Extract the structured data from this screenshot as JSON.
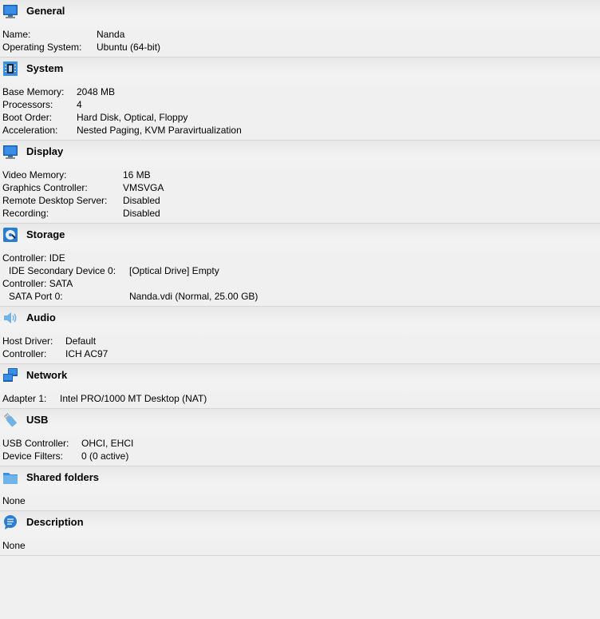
{
  "sections": {
    "general": {
      "title": "General",
      "icon": "monitor-icon",
      "rows": [
        {
          "label": "Name:",
          "value": "Nanda"
        },
        {
          "label": "Operating System:",
          "value": "Ubuntu (64-bit)"
        }
      ]
    },
    "system": {
      "title": "System",
      "icon": "chip-icon",
      "rows": [
        {
          "label": "Base Memory:",
          "value": "2048 MB"
        },
        {
          "label": "Processors:",
          "value": "4"
        },
        {
          "label": "Boot Order:",
          "value": "Hard Disk, Optical, Floppy"
        },
        {
          "label": "Acceleration:",
          "value": "Nested Paging, KVM Paravirtualization"
        }
      ]
    },
    "display": {
      "title": "Display",
      "icon": "monitor-icon",
      "rows": [
        {
          "label": "Video Memory:",
          "value": "16 MB"
        },
        {
          "label": "Graphics Controller:",
          "value": "VMSVGA"
        },
        {
          "label": "Remote Desktop Server:",
          "value": "Disabled"
        },
        {
          "label": "Recording:",
          "value": "Disabled"
        }
      ]
    },
    "storage": {
      "title": "Storage",
      "icon": "storage-disk-icon",
      "controller_ide": "Controller: IDE",
      "ide_device": {
        "label": "IDE Secondary Device 0:",
        "value": "[Optical Drive] Empty"
      },
      "controller_sata": "Controller: SATA",
      "sata_port": {
        "label": "SATA Port 0:",
        "value": "Nanda.vdi (Normal, 25.00 GB)"
      }
    },
    "audio": {
      "title": "Audio",
      "icon": "speaker-icon",
      "rows": [
        {
          "label": "Host Driver:",
          "value": "Default"
        },
        {
          "label": "Controller:",
          "value": "ICH AC97"
        }
      ]
    },
    "network": {
      "title": "Network",
      "icon": "network-icon",
      "rows": [
        {
          "label": "Adapter 1:",
          "value": "Intel PRO/1000 MT Desktop (NAT)"
        }
      ]
    },
    "usb": {
      "title": "USB",
      "icon": "usb-icon",
      "rows": [
        {
          "label": "USB Controller:",
          "value": "OHCI, EHCI"
        },
        {
          "label": "Device Filters:",
          "value": "0 (0 active)"
        }
      ]
    },
    "shared_folders": {
      "title": "Shared folders",
      "icon": "folder-icon",
      "value": "None"
    },
    "description": {
      "title": "Description",
      "icon": "speech-bubble-icon",
      "value": "None"
    }
  }
}
